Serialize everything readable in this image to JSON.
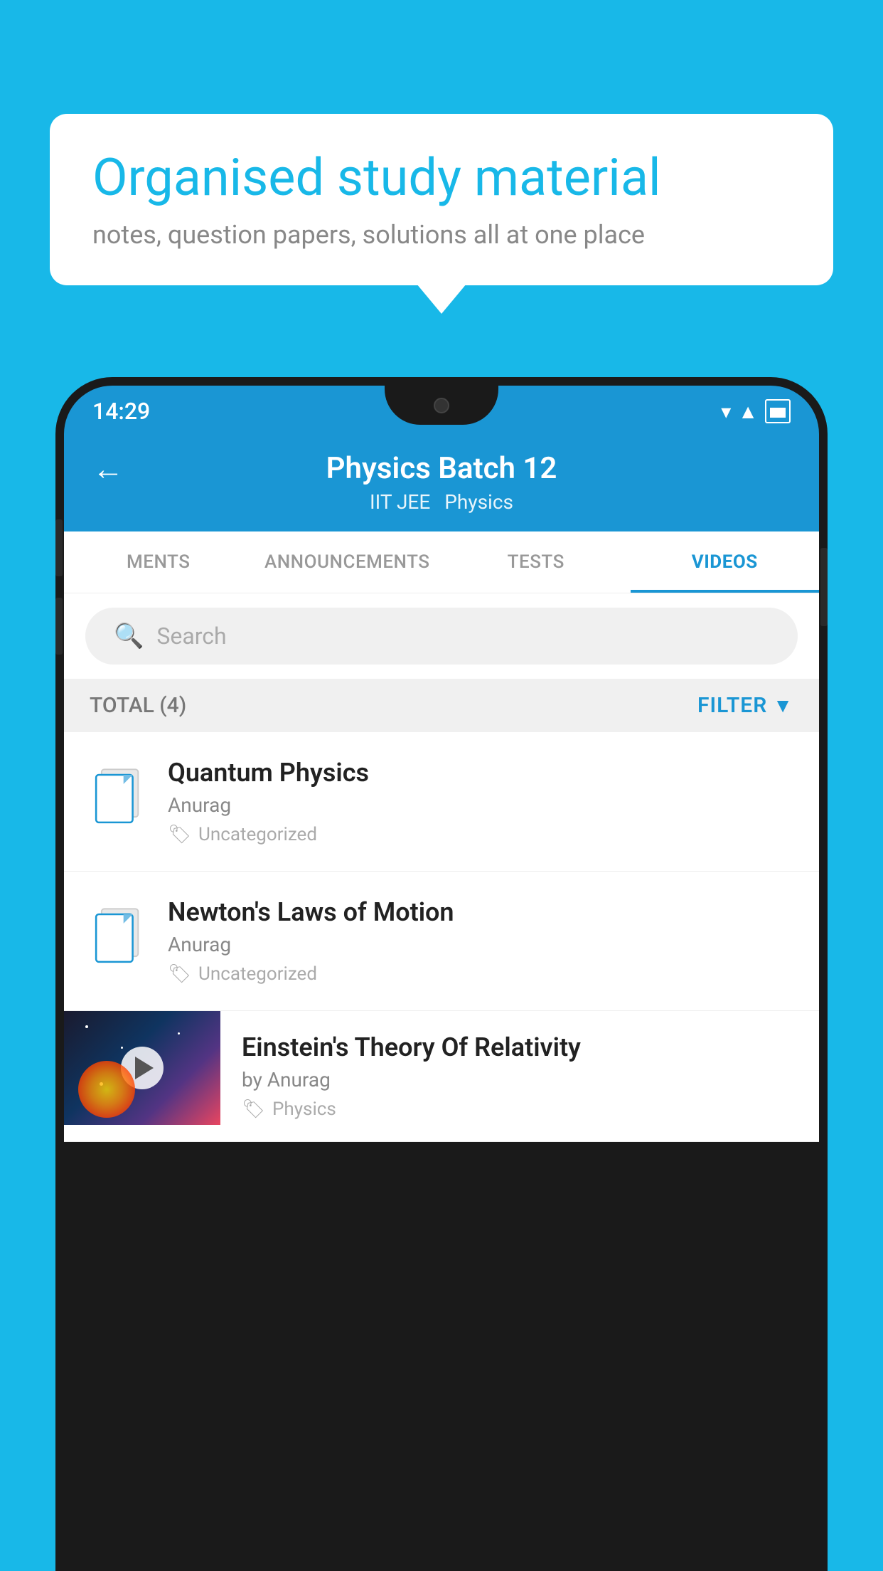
{
  "background_color": "#18b8e8",
  "speech_bubble": {
    "title": "Organised study material",
    "subtitle": "notes, question papers, solutions all at one place"
  },
  "phone": {
    "status_bar": {
      "time": "14:29",
      "icons": [
        "wifi",
        "signal",
        "battery"
      ]
    },
    "header": {
      "back_label": "←",
      "title": "Physics Batch 12",
      "subtitle1": "IIT JEE",
      "subtitle2": "Physics"
    },
    "tabs": [
      {
        "label": "MENTS",
        "active": false
      },
      {
        "label": "ANNOUNCEMENTS",
        "active": false
      },
      {
        "label": "TESTS",
        "active": false
      },
      {
        "label": "VIDEOS",
        "active": true
      }
    ],
    "search": {
      "placeholder": "Search"
    },
    "filter_bar": {
      "total_label": "TOTAL (4)",
      "filter_label": "FILTER"
    },
    "videos": [
      {
        "id": 1,
        "title": "Quantum Physics",
        "author": "Anurag",
        "tag": "Uncategorized",
        "has_thumb": false
      },
      {
        "id": 2,
        "title": "Newton's Laws of Motion",
        "author": "Anurag",
        "tag": "Uncategorized",
        "has_thumb": false
      },
      {
        "id": 3,
        "title": "Einstein's Theory Of Relativity",
        "author": "by Anurag",
        "tag": "Physics",
        "has_thumb": true
      }
    ]
  }
}
